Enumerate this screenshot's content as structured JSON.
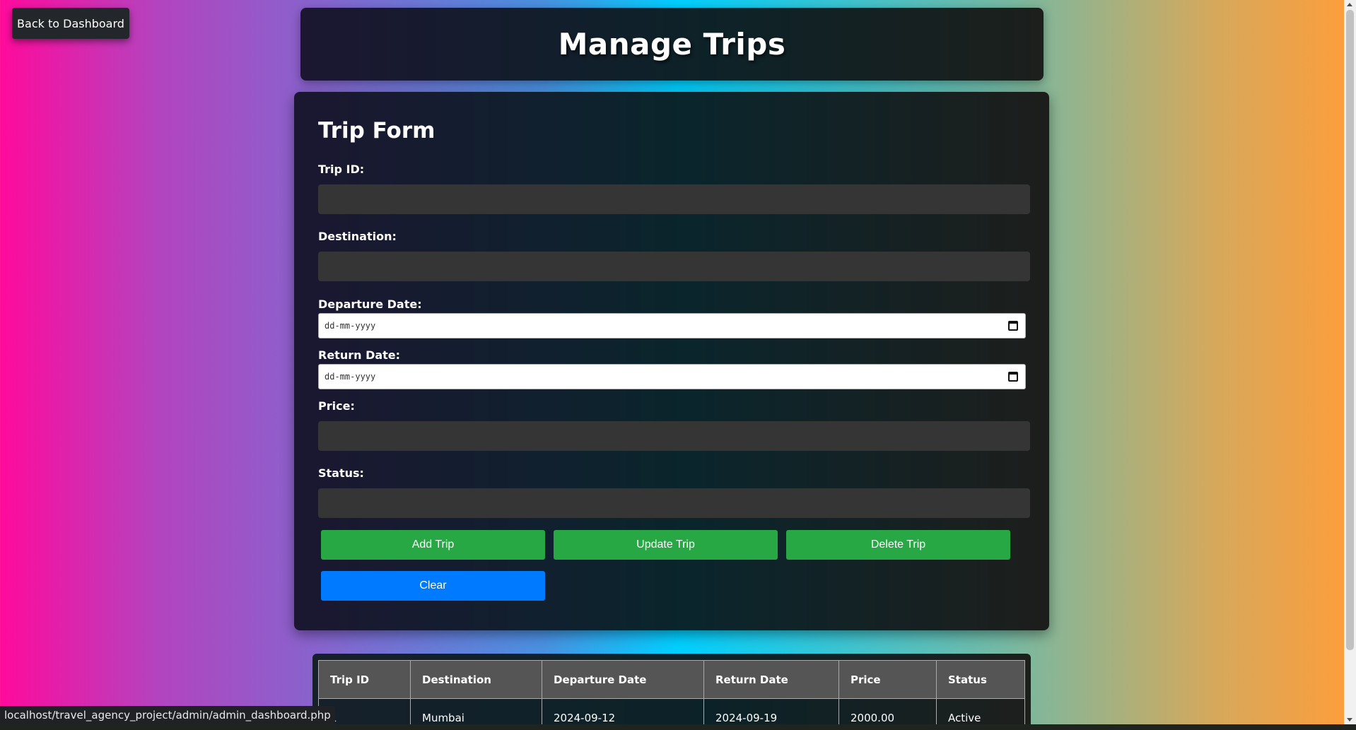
{
  "nav": {
    "back_label": "Back to Dashboard"
  },
  "header": {
    "title": "Manage Trips"
  },
  "form": {
    "title": "Trip Form",
    "fields": {
      "trip_id": {
        "label": "Trip ID:",
        "value": ""
      },
      "destination": {
        "label": "Destination:",
        "value": ""
      },
      "departure_date": {
        "label": "Departure Date:",
        "placeholder": "dd-mm-yyyy"
      },
      "return_date": {
        "label": "Return Date:",
        "placeholder": "dd-mm-yyyy"
      },
      "price": {
        "label": "Price:",
        "value": ""
      },
      "status": {
        "label": "Status:",
        "value": ""
      }
    },
    "buttons": {
      "add": "Add Trip",
      "update": "Update Trip",
      "delete": "Delete Trip",
      "clear": "Clear"
    }
  },
  "table": {
    "headers": [
      "Trip ID",
      "Destination",
      "Departure Date",
      "Return Date",
      "Price",
      "Status"
    ],
    "rows": [
      [
        "1",
        "Mumbai",
        "2024-09-12",
        "2024-09-19",
        "2000.00",
        "Active"
      ]
    ]
  },
  "statusbar": {
    "url": "localhost/travel_agency_project/admin/admin_dashboard.php"
  },
  "colors": {
    "primary_button": "#28a745",
    "clear_button": "#007bff",
    "input_bg": "#353535"
  }
}
